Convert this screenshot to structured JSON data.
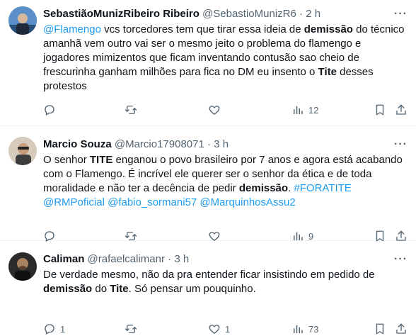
{
  "tweets": [
    {
      "name": "SebastiãoMunizRibeiro Ribeiro",
      "handle": "@SebastioMunizR6",
      "dot": "·",
      "time": "2 h",
      "text": [
        {
          "t": "@Flamengo",
          "s": "link"
        },
        {
          "t": " vcs torcedores tem que tirar essa ideia de ",
          "s": "plain"
        },
        {
          "t": "demissão",
          "s": "bold"
        },
        {
          "t": " do técnico amanhã vem outro vai ser o mesmo jeito o problema do flamengo e jogadores mimizentos que ficam inventando contusão sao cheio de frescurinha  ganham milhões para fica no DM eu insento o ",
          "s": "plain"
        },
        {
          "t": "Tite",
          "s": "bold"
        },
        {
          "t": " desses protestos",
          "s": "plain"
        }
      ],
      "views": "12",
      "replies": "",
      "likes": ""
    },
    {
      "name": "Marcio Souza",
      "handle": "@Marcio17908071",
      "dot": "·",
      "time": "3 h",
      "text": [
        {
          "t": "O senhor ",
          "s": "plain"
        },
        {
          "t": "TITE",
          "s": "bold"
        },
        {
          "t": " enganou o povo brasileiro por 7 anos e agora está acabando com o Flamengo. É incrível ele querer ser o senhor da ética e de toda moralidade e não ter a decência de pedir ",
          "s": "plain"
        },
        {
          "t": "demissão",
          "s": "bold"
        },
        {
          "t": ". ",
          "s": "plain"
        },
        {
          "t": "#FORATITE",
          "s": "link"
        },
        {
          "t": " ",
          "s": "plain"
        },
        {
          "t": "@RMPoficial",
          "s": "link"
        },
        {
          "t": " ",
          "s": "plain"
        },
        {
          "t": "@fabio_sormani57",
          "s": "link"
        },
        {
          "t": " ",
          "s": "plain"
        },
        {
          "t": "@MarquinhosAssu2",
          "s": "link"
        }
      ],
      "views": "9",
      "replies": "",
      "likes": ""
    },
    {
      "name": "Caliman",
      "handle": "@rafaelcalimanr",
      "dot": "·",
      "time": "3 h",
      "text": [
        {
          "t": "De verdade mesmo, não da pra entender ficar insistindo em pedido de ",
          "s": "plain"
        },
        {
          "t": "demissão",
          "s": "bold"
        },
        {
          "t": " do ",
          "s": "plain"
        },
        {
          "t": "Tite",
          "s": "bold"
        },
        {
          "t": ". Só pensar um pouquinho.",
          "s": "plain"
        }
      ],
      "views": "73",
      "replies": "1",
      "likes": "1"
    }
  ],
  "icons": [
    "reply-icon",
    "retweet-icon",
    "like-icon",
    "views-icon",
    "bookmark-icon",
    "share-icon",
    "more-icon"
  ],
  "colors": {
    "link": "#1d9bf0",
    "muted": "#536471",
    "text": "#0f1419",
    "divider": "#eff3f4"
  }
}
